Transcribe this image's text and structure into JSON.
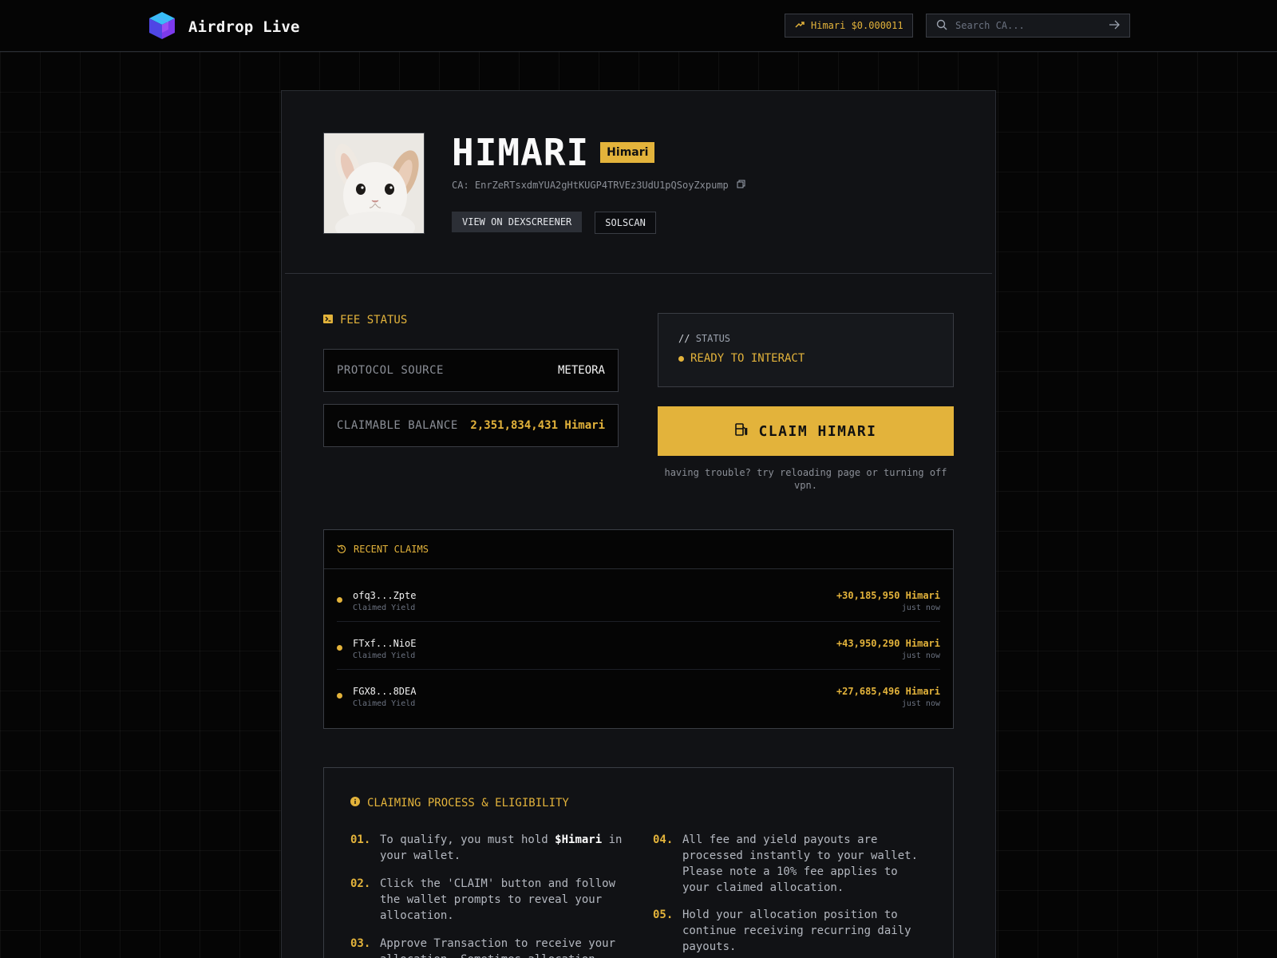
{
  "header": {
    "brand": "Airdrop Live",
    "price_chip": "Himari $0.000011",
    "search_placeholder": "Search CA..."
  },
  "token": {
    "name": "HIMARI",
    "ticker": "Himari",
    "ca": "CA: EnrZeRTsxdmYUA2gHtKUGP4TRVEz3UdU1pQSoyZxpump",
    "dexscreener_label": "VIEW ON DEXSCREENER",
    "solscan_label": "SOLSCAN"
  },
  "fee_status": {
    "heading": "FEE STATUS",
    "protocol_label": "PROTOCOL SOURCE",
    "protocol_value": "METEORA",
    "balance_label": "CLAIMABLE BALANCE",
    "balance_value": "2,351,834,431 Himari"
  },
  "status": {
    "label": "STATUS",
    "value": "READY TO INTERACT"
  },
  "claim": {
    "button_label": "CLAIM HIMARI",
    "trouble_text": "having trouble? try reloading page or turning off vpn."
  },
  "recent_claims": {
    "heading": "RECENT CLAIMS",
    "rows": [
      {
        "address": "ofq3...Zpte",
        "sub": "Claimed Yield",
        "amount": "+30,185,950 Himari",
        "time": "just now"
      },
      {
        "address": "FTxf...NioE",
        "sub": "Claimed Yield",
        "amount": "+43,950,290 Himari",
        "time": "just now"
      },
      {
        "address": "FGX8...8DEA",
        "sub": "Claimed Yield",
        "amount": "+27,685,496 Himari",
        "time": "just now"
      }
    ]
  },
  "process": {
    "heading": "CLAIMING PROCESS & ELIGIBILITY",
    "steps": [
      {
        "num": "01.",
        "text_before": "To qualify, you must hold ",
        "highlight": "$Himari",
        "text_after": " in your wallet."
      },
      {
        "num": "02.",
        "text": "Click the 'CLAIM' button and follow the wallet prompts to reveal your allocation."
      },
      {
        "num": "03.",
        "text": "Approve Transaction to receive your allocation. Sometimes allocation"
      },
      {
        "num": "04.",
        "text": "All fee and yield payouts are processed instantly to your wallet. Please note a 10% fee applies to your claimed allocation."
      },
      {
        "num": "05.",
        "text": "Hold your allocation position to continue receiving recurring daily payouts."
      }
    ]
  },
  "colors": {
    "accent": "#e3b33b",
    "background": "#050505",
    "card": "#111215",
    "logo": "#5b5cf0"
  },
  "icons": [
    "cube-logo-icon",
    "trending-up-icon",
    "search-icon",
    "arrow-right-icon",
    "copy-icon",
    "terminal-icon",
    "fuel-icon",
    "history-icon",
    "info-icon"
  ]
}
